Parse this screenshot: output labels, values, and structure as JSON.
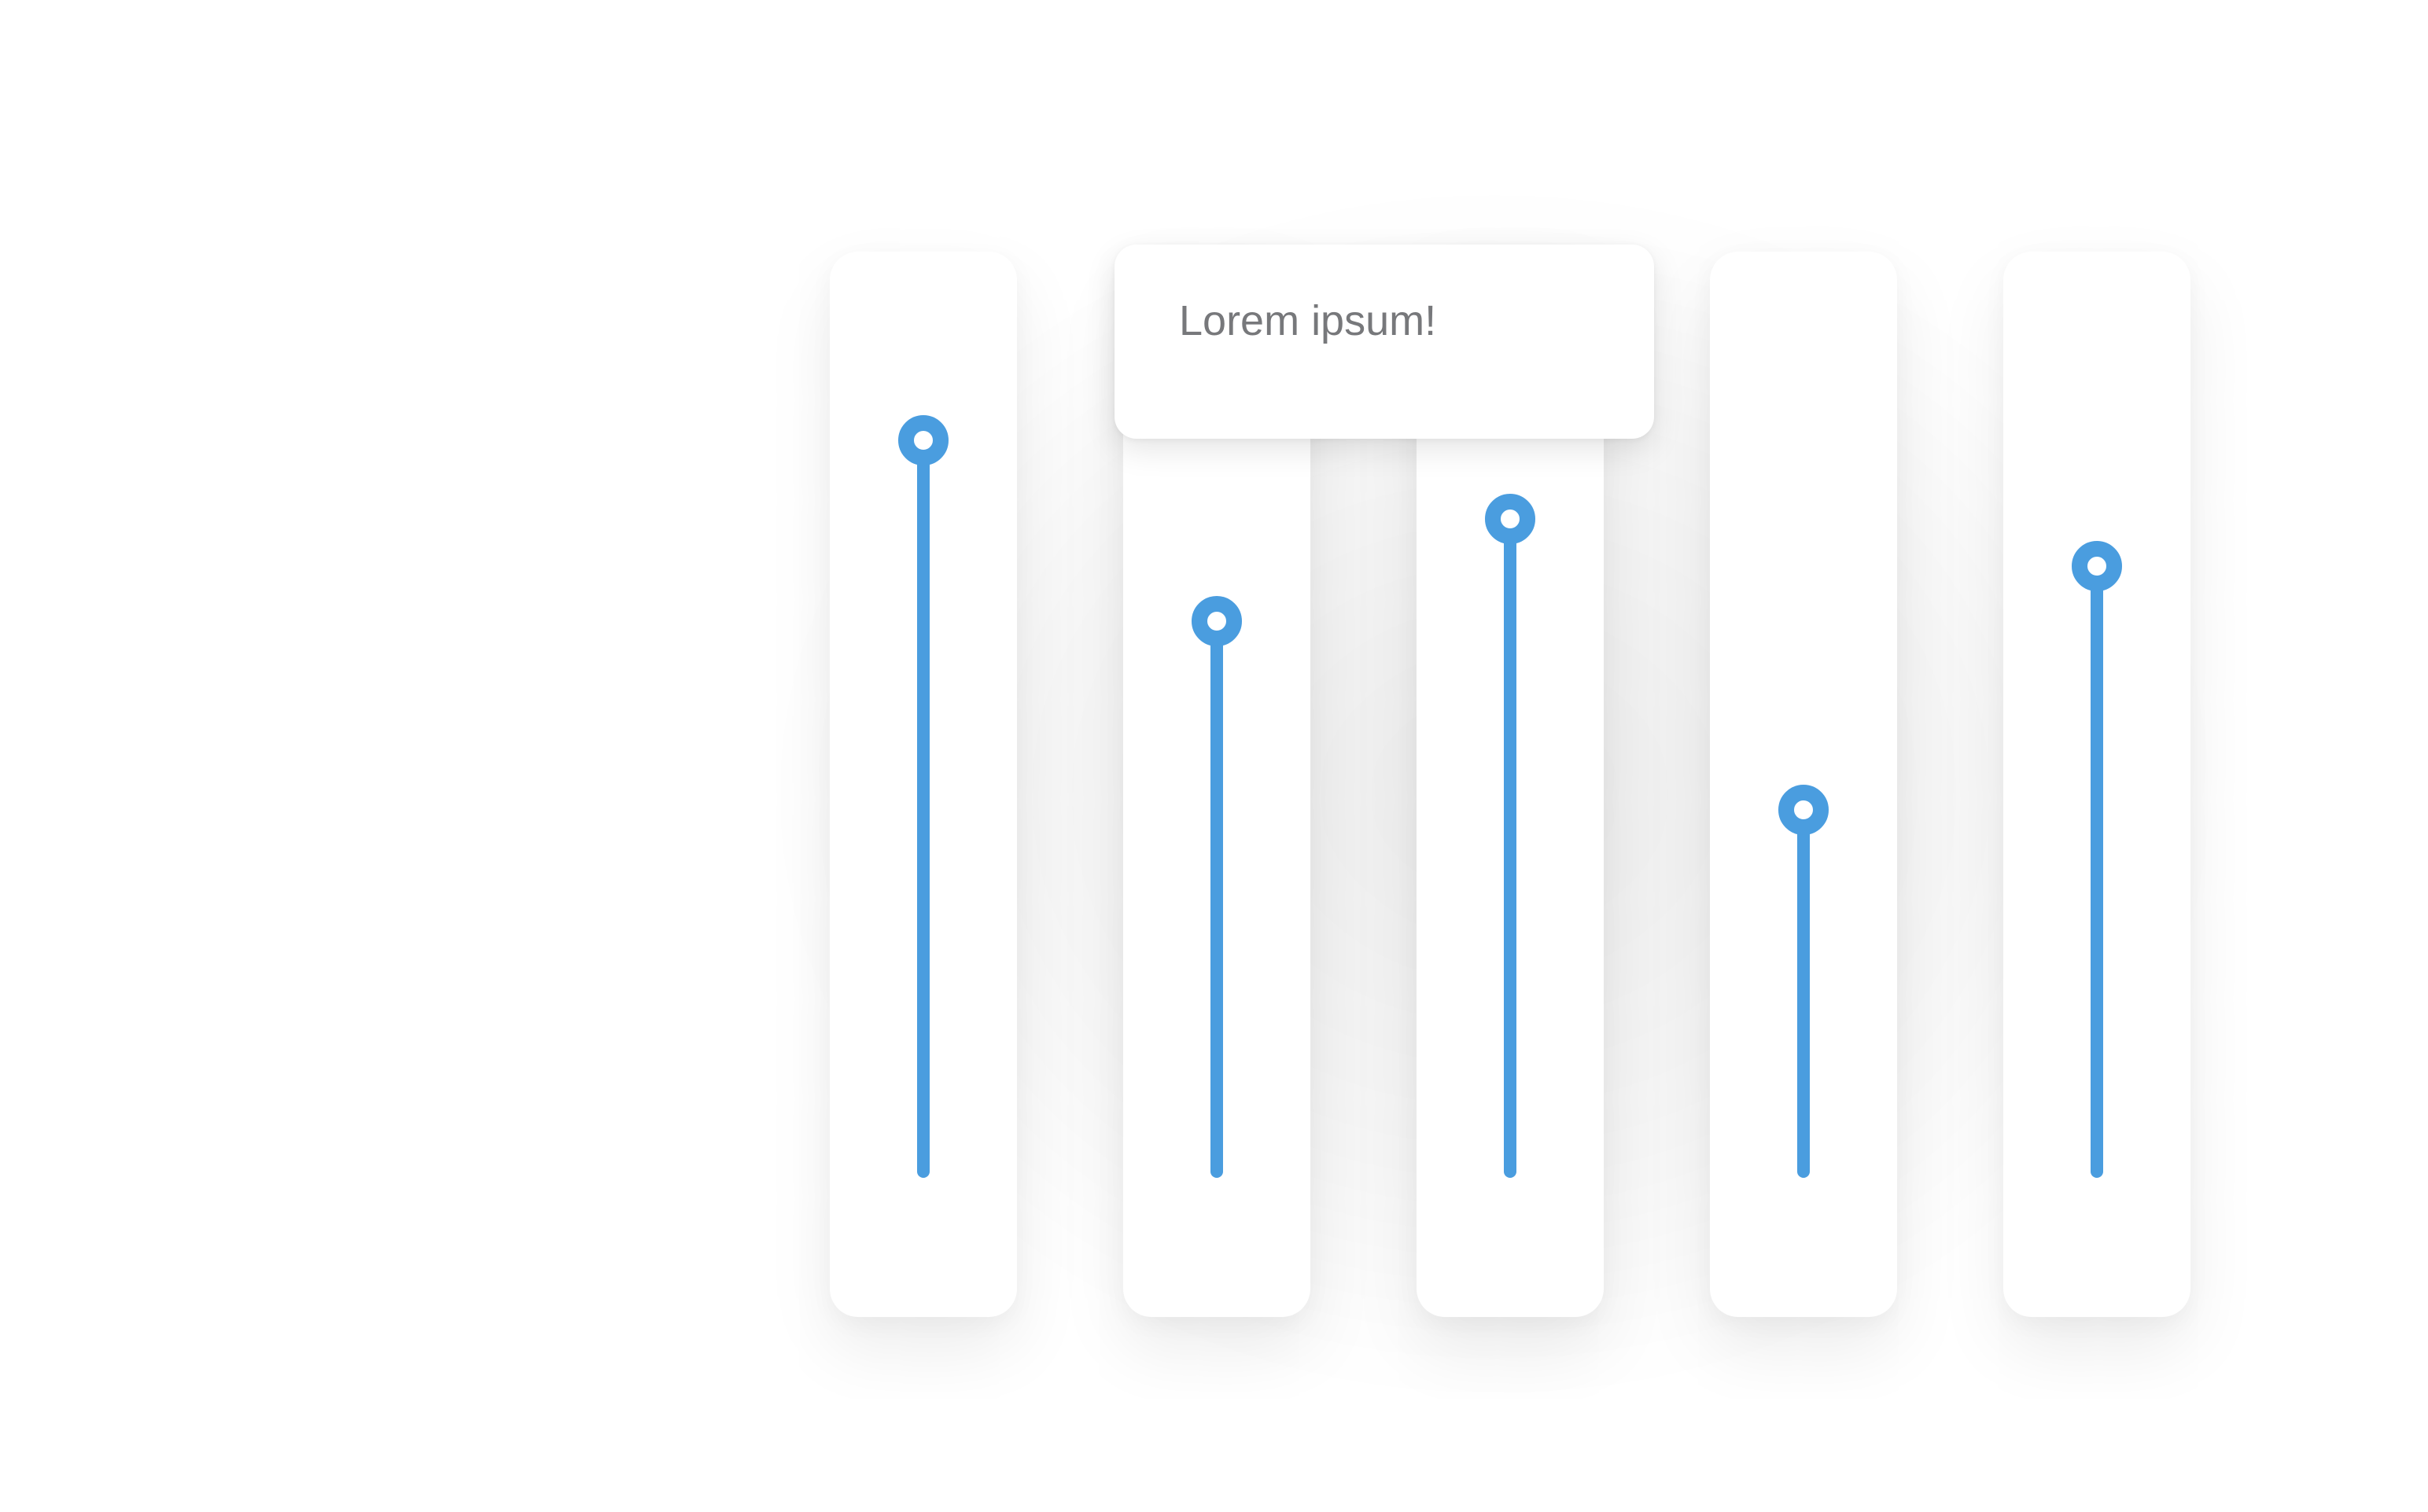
{
  "accent_color": "#4a9ddf",
  "tooltip": {
    "text": "Lorem ipsum!"
  },
  "sliders": [
    {
      "name": "slider-1",
      "value": 0.93
    },
    {
      "name": "slider-2",
      "value": 0.7
    },
    {
      "name": "slider-3",
      "value": 0.83
    },
    {
      "name": "slider-4",
      "value": 0.46
    },
    {
      "name": "slider-5",
      "value": 0.77
    }
  ]
}
